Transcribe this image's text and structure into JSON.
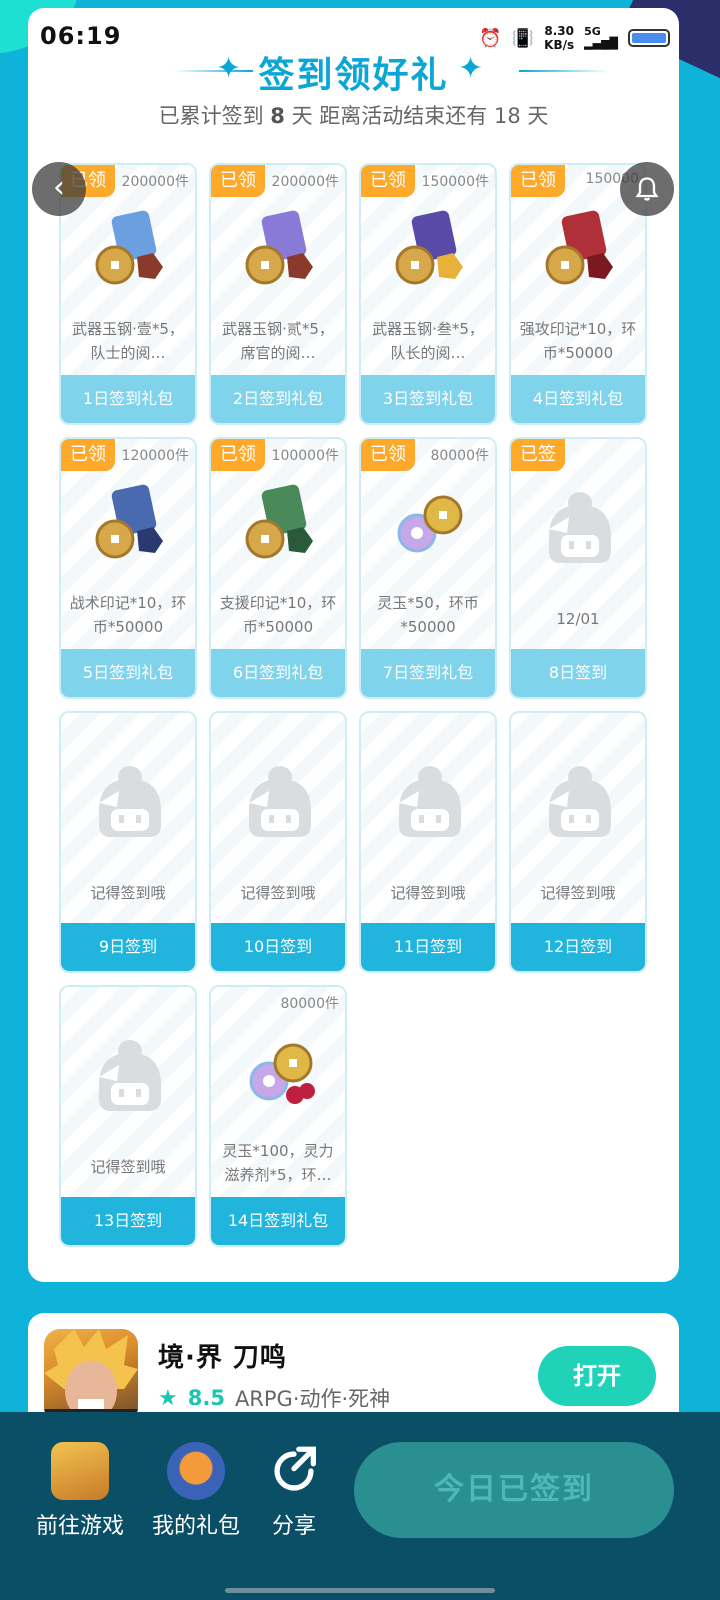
{
  "status_bar": {
    "time": "06:19",
    "speed_value": "8.30",
    "speed_unit": "KB/s",
    "network": "5G"
  },
  "header": {
    "title": "签到领好礼",
    "subtitle_prefix": "已累计签到",
    "signed_days": "8",
    "subtitle_mid": "天  距离活动结束还有",
    "days_left": "18",
    "subtitle_suffix": "天"
  },
  "cards": [
    {
      "badge": "已领",
      "qty": "200000件",
      "desc": "武器玉钢·壹*5，队士的阅…",
      "footer": "1日签到礼包",
      "type": "gift"
    },
    {
      "badge": "已领",
      "qty": "200000件",
      "desc": "武器玉钢·贰*5，席官的阅…",
      "footer": "2日签到礼包",
      "type": "gift"
    },
    {
      "badge": "已领",
      "qty": "150000件",
      "desc": "武器玉钢·叁*5，队长的阅…",
      "footer": "3日签到礼包",
      "type": "gift"
    },
    {
      "badge": "已领",
      "qty": "150000",
      "desc": "强攻印记*10，环币*50000",
      "footer": "4日签到礼包",
      "type": "gift"
    },
    {
      "badge": "已领",
      "qty": "120000件",
      "desc": "战术印记*10，环币*50000",
      "footer": "5日签到礼包",
      "type": "gift"
    },
    {
      "badge": "已领",
      "qty": "100000件",
      "desc": "支援印记*10，环币*50000",
      "footer": "6日签到礼包",
      "type": "gift"
    },
    {
      "badge": "已领",
      "qty": "80000件",
      "desc": "灵玉*50，环币*50000",
      "footer": "7日签到礼包",
      "type": "gift"
    },
    {
      "badge": "已签",
      "qty": "",
      "desc": "12/01",
      "footer": "8日签到",
      "type": "placeholder"
    },
    {
      "badge": "",
      "qty": "",
      "desc": "记得签到哦",
      "footer": "9日签到",
      "type": "placeholder"
    },
    {
      "badge": "",
      "qty": "",
      "desc": "记得签到哦",
      "footer": "10日签到",
      "type": "placeholder"
    },
    {
      "badge": "",
      "qty": "",
      "desc": "记得签到哦",
      "footer": "11日签到",
      "type": "placeholder"
    },
    {
      "badge": "",
      "qty": "",
      "desc": "记得签到哦",
      "footer": "12日签到",
      "type": "placeholder"
    },
    {
      "badge": "",
      "qty": "",
      "desc": "记得签到哦",
      "footer": "13日签到",
      "type": "placeholder"
    },
    {
      "badge": "",
      "qty": "80000件",
      "desc": "灵玉*100，灵力滋养剂*5，环…",
      "footer": "14日签到礼包",
      "type": "gift"
    }
  ],
  "game": {
    "name": "境·界 刀鸣",
    "rating": "8.5",
    "tags": "ARPG·动作·死神",
    "open_label": "打开"
  },
  "bottom_nav": {
    "goto_label": "前往游戏",
    "gift_label": "我的礼包",
    "share_label": "分享",
    "signed_label": "今日已签到"
  },
  "colors": {
    "accent": "#0aa6d6",
    "badge": "#ffa92a",
    "teal": "#20d2b8",
    "bottom_bar": "#0b4f66"
  },
  "icons": [
    "back-icon",
    "bell-icon",
    "alarm-icon",
    "vibrate-icon",
    "battery-icon",
    "star-icon",
    "share-icon"
  ]
}
